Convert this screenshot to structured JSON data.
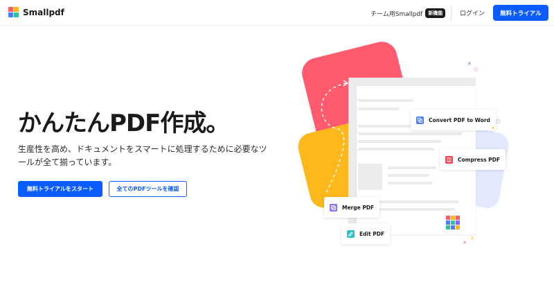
{
  "header": {
    "brand": "Smallpdf",
    "team_label": "チーム用Smallpdf",
    "team_badge": "新機能",
    "login": "ログイン",
    "trial_button": "無料トライアル"
  },
  "hero": {
    "title": "かんたんPDF作成。",
    "subtitle": "生産性を高め、ドキュメントをスマートに処理するために必要なツールが全て揃っています。",
    "cta_primary": "無料トライアルをスタート",
    "cta_secondary": "全てのPDFツールを確認"
  },
  "tools": [
    {
      "label": "Convert PDF to Word",
      "icon": "convert-icon",
      "color": "#4c7dff"
    },
    {
      "label": "Compress PDF",
      "icon": "compress-icon",
      "color": "#ff3b4a"
    },
    {
      "label": "Merge PDF",
      "icon": "merge-icon",
      "color": "#8b6bff"
    },
    {
      "label": "Edit PDF",
      "icon": "edit-icon",
      "color": "#2ec4c4"
    }
  ],
  "colors": {
    "accent": "#0b5cff",
    "card_red": "#ff5a6e",
    "card_yellow": "#ffb81c",
    "card_blue": "#e3eaff"
  }
}
